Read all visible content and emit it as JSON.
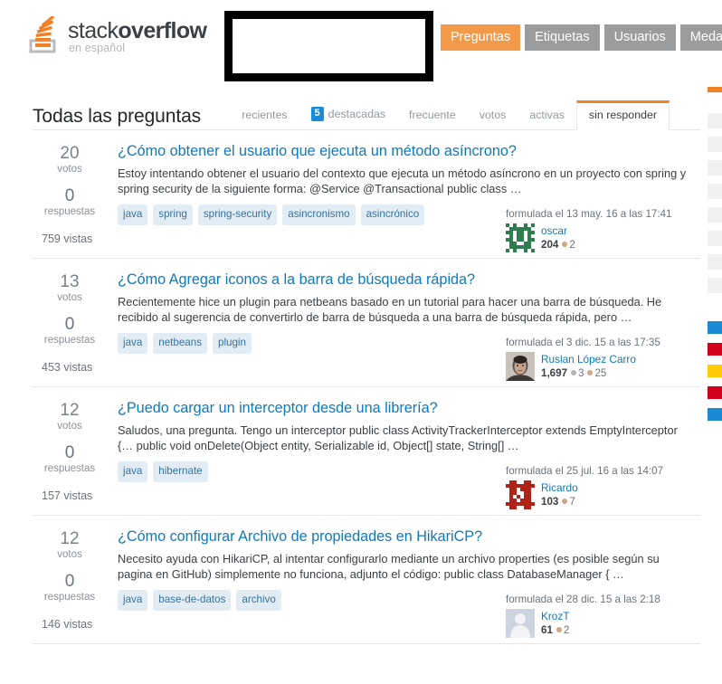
{
  "site": {
    "logo_word_light": "stack",
    "logo_word_bold": "overflow",
    "logo_sub": "en español",
    "logo_icon": "stack-overflow-logo-icon"
  },
  "topnav": {
    "items": [
      {
        "label": "Preguntas",
        "active": true
      },
      {
        "label": "Etiquetas",
        "active": false
      },
      {
        "label": "Usuarios",
        "active": false
      },
      {
        "label": "Medallas",
        "active": false
      }
    ]
  },
  "header": {
    "page_title": "Todas las preguntas"
  },
  "tabs": [
    {
      "label": "recientes",
      "badge": "",
      "active": false
    },
    {
      "label": "destacadas",
      "badge": "5",
      "active": false
    },
    {
      "label": "frecuente",
      "badge": "",
      "active": false
    },
    {
      "label": "votos",
      "badge": "",
      "active": false
    },
    {
      "label": "activas",
      "badge": "",
      "active": false
    },
    {
      "label": "sin responder",
      "badge": "",
      "active": true
    }
  ],
  "labels": {
    "votes": "votos",
    "answers": "respuestas",
    "views_suffix": "vistas"
  },
  "questions": [
    {
      "votes": "20",
      "votes_label": "votos",
      "answers": "0",
      "answers_label": "respuestas",
      "views": "759 vistas",
      "title": "¿Cómo obtener el usuario que ejecuta un método asíncrono?",
      "excerpt": "Estoy intentando obtener el usuario del contexto que ejecuta un método asíncrono en un proyecto con spring y spring security de la siguiente forma: @Service @Transactional public class …",
      "tags": [
        "java",
        "spring",
        "spring-security",
        "asincronismo",
        "asincrónico"
      ],
      "asked": "formulada el 13 may. 16 a las 17:41",
      "user": "oscar",
      "reputation": "204",
      "badges": [
        {
          "type": "bronze",
          "count": "2"
        }
      ],
      "avatar": "identicon-green"
    },
    {
      "votes": "13",
      "votes_label": "votos",
      "answers": "0",
      "answers_label": "respuestas",
      "views": "453 vistas",
      "title": "¿Cómo Agregar iconos a la barra de búsqueda rápida?",
      "excerpt": "Recientemente hice un plugin para netbeans basado en un tutorial para hacer una barra de búsqueda. He recibido al sugerencia de convertirlo de barra de búsqueda a una barra de búsqueda rápida, pero …",
      "tags": [
        "java",
        "netbeans",
        "plugin"
      ],
      "asked": "formulada el 3 dic. 15 a las 17:35",
      "user": "Ruslan López Carro",
      "reputation": "1,697",
      "badges": [
        {
          "type": "silver",
          "count": "3"
        },
        {
          "type": "bronze",
          "count": "25"
        }
      ],
      "avatar": "photo-face"
    },
    {
      "votes": "12",
      "votes_label": "votos",
      "answers": "0",
      "answers_label": "respuestas",
      "views": "157 vistas",
      "title": "¿Puedo cargar un interceptor desde una librería?",
      "excerpt": "Saludos, una pregunta. Tengo un interceptor public class ActivityTrackerInterceptor extends EmptyInterceptor {… public void onDelete(Object entity, Serializable id, Object[] state, String[] …",
      "tags": [
        "java",
        "hibernate"
      ],
      "asked": "formulada el 25 jul. 16 a las 14:07",
      "user": "Ricardo",
      "reputation": "103",
      "badges": [
        {
          "type": "bronze",
          "count": "7"
        }
      ],
      "avatar": "identicon-red"
    },
    {
      "votes": "12",
      "votes_label": "votos",
      "answers": "0",
      "answers_label": "respuestas",
      "views": "146 vistas",
      "title": "¿Cómo configurar Archivo de propiedades en HikariCP?",
      "excerpt": "Necesito ayuda con HikariCP, al intentar configurarlo mediante un archivo properties (es posible según su pagina en GitHub) simplemente no funciona, adjunto el código: public class DatabaseManager { …",
      "tags": [
        "java",
        "base-de-datos",
        "archivo"
      ],
      "asked": "formulada el 28 dic. 15 a las 2:18",
      "user": "KrozT",
      "reputation": "61",
      "badges": [
        {
          "type": "bronze",
          "count": "2"
        }
      ],
      "avatar": "default-silhouette"
    }
  ],
  "colors": {
    "accent_orange": "#f48024",
    "nav_grey": "#9a9c9e",
    "link_blue": "#0b7bc1",
    "tag_bg": "#e1ecf4",
    "tag_text": "#39739d",
    "badge_blue": "#1a8ad6"
  }
}
